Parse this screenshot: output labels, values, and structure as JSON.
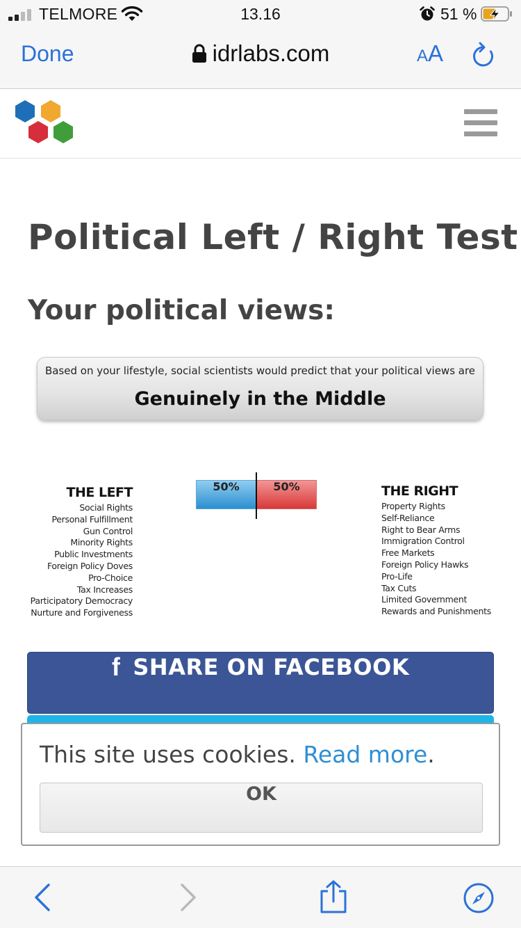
{
  "status_bar": {
    "carrier": "TELMORE",
    "time": "13.16",
    "battery_percent": "51 %",
    "signal_bars": 2,
    "icons": [
      "signal-icon",
      "wifi-icon",
      "alarm-icon",
      "battery-charging-icon"
    ]
  },
  "browser": {
    "done_label": "Done",
    "url": "idrlabs.com",
    "text_size_small": "A",
    "text_size_big": "A",
    "icons": [
      "lock-icon",
      "reload-icon"
    ]
  },
  "site_header": {
    "logo": "idrlabs-logo",
    "menu_icon": "hamburger-icon",
    "logo_colors": [
      "#1f6fb8",
      "#f0a830",
      "#d62e3a",
      "#3f9e3a"
    ]
  },
  "main": {
    "title": "Political Left / Right Test",
    "subtitle": "Your political views:",
    "result": {
      "caption": "Based on your lifestyle, social scientists would predict that your political views are",
      "verdict": "Genuinely in the Middle"
    },
    "left": {
      "heading": "THE LEFT",
      "items": [
        "Social Rights",
        "Personal Fulfillment",
        "Gun Control",
        "Minority Rights",
        "Public Investments",
        "Foreign Policy Doves",
        "Pro-Choice",
        "Tax Increases",
        "Participatory Democracy",
        "Nurture and Forgiveness"
      ]
    },
    "right": {
      "heading": "THE RIGHT",
      "items": [
        "Property Rights",
        "Self-Reliance",
        "Right to Bear Arms",
        "Immigration Control",
        "Free Markets",
        "Foreign Policy Hawks",
        "Pro-Life",
        "Tax Cuts",
        "Limited Government",
        "Rewards and Punishments"
      ]
    },
    "bar": {
      "left_fraction": 0.5,
      "right_fraction": 0.5,
      "left_label": "50%",
      "right_label": "50%",
      "left_color": "#2c8fd0",
      "right_color": "#d93838"
    },
    "share": {
      "facebook_icon": "f",
      "facebook_label": "SHARE ON FACEBOOK",
      "facebook_color": "#3b5596",
      "twitter_color": "#1fb5e8"
    }
  },
  "cookie_banner": {
    "text": "This site uses cookies. ",
    "link": "Read more",
    "link_suffix": ".",
    "ok_label": "OK"
  },
  "toolbar": {
    "icons": [
      "back-icon",
      "forward-icon",
      "share-icon",
      "compass-icon"
    ],
    "accent": "#2a72d8"
  }
}
